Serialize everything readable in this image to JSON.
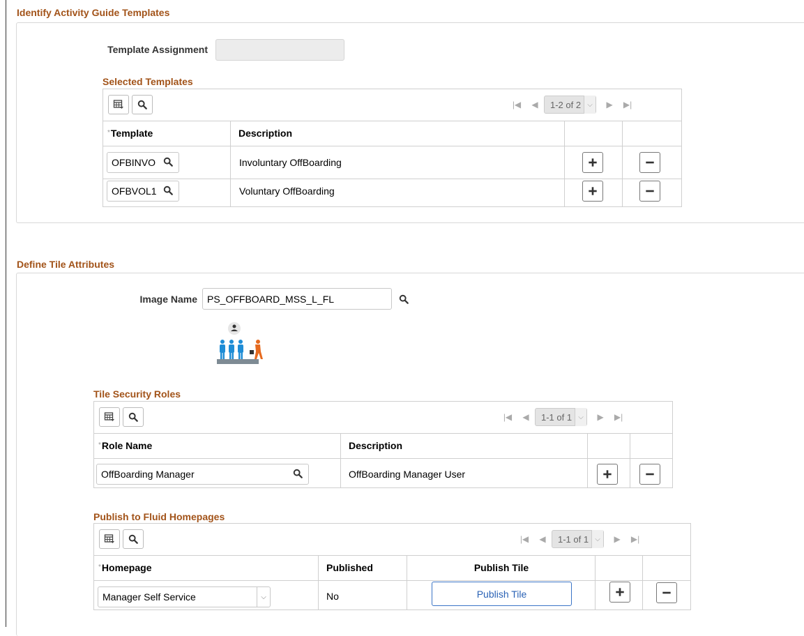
{
  "sections": {
    "identify": {
      "title": "Identify Activity Guide Templates",
      "template_assignment_label": "Template Assignment",
      "template_assignment_value": "",
      "selected_templates": {
        "title": "Selected Templates",
        "pager": "1-2 of 2",
        "columns": [
          "Template",
          "Description"
        ],
        "rows": [
          {
            "template": "OFBINVO",
            "description": "Involuntary OffBoarding"
          },
          {
            "template": "OFBVOL1",
            "description": "Voluntary OffBoarding"
          }
        ]
      }
    },
    "tile": {
      "title": "Define Tile Attributes",
      "image_name_label": "Image Name",
      "image_name_value": "PS_OFFBOARD_MSS_L_FL",
      "security_roles": {
        "title": "Tile Security Roles",
        "pager": "1-1 of 1",
        "columns": [
          "Role Name",
          "Description"
        ],
        "rows": [
          {
            "role": "OffBoarding Manager",
            "description": "OffBoarding Manager User"
          }
        ]
      },
      "homepages": {
        "title": "Publish to Fluid Homepages",
        "pager": "1-1 of 1",
        "columns": [
          "Homepage",
          "Published",
          "Publish Tile"
        ],
        "rows": [
          {
            "homepage": "Manager Self Service",
            "published": "No",
            "publish_button": "Publish Tile"
          }
        ]
      }
    }
  },
  "colors": {
    "section_title": "#a25319",
    "link_blue": "#2a62b5",
    "icon_blue": "#1f8dd6",
    "icon_orange": "#e66a1f"
  },
  "icons": [
    "grid-settings-icon",
    "search-icon",
    "first-page-icon",
    "prev-page-icon",
    "next-page-icon",
    "last-page-icon",
    "add-row-icon",
    "delete-row-icon",
    "dropdown-icon"
  ]
}
